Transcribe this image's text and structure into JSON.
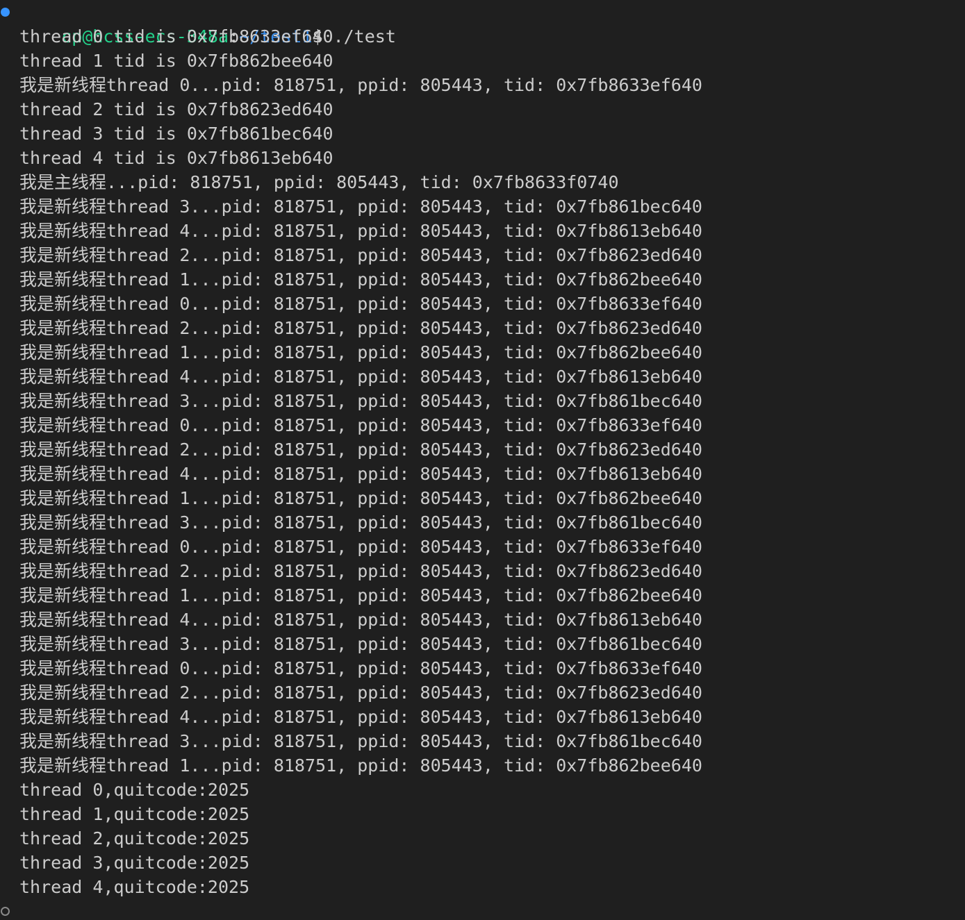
{
  "prompt": {
    "user_host": "cp@hcss-ecs-348a",
    "cwd": "~/test1",
    "symbol": "$",
    "command": " ./test"
  },
  "output_lines": [
    "thread 0 tid is 0x7fb8633ef640",
    "thread 1 tid is 0x7fb862bee640",
    "我是新线程thread 0...pid: 818751, ppid: 805443, tid: 0x7fb8633ef640",
    "thread 2 tid is 0x7fb8623ed640",
    "thread 3 tid is 0x7fb861bec640",
    "thread 4 tid is 0x7fb8613eb640",
    "我是主线程...pid: 818751, ppid: 805443, tid: 0x7fb8633f0740",
    "我是新线程thread 3...pid: 818751, ppid: 805443, tid: 0x7fb861bec640",
    "我是新线程thread 4...pid: 818751, ppid: 805443, tid: 0x7fb8613eb640",
    "我是新线程thread 2...pid: 818751, ppid: 805443, tid: 0x7fb8623ed640",
    "我是新线程thread 1...pid: 818751, ppid: 805443, tid: 0x7fb862bee640",
    "我是新线程thread 0...pid: 818751, ppid: 805443, tid: 0x7fb8633ef640",
    "我是新线程thread 2...pid: 818751, ppid: 805443, tid: 0x7fb8623ed640",
    "我是新线程thread 1...pid: 818751, ppid: 805443, tid: 0x7fb862bee640",
    "我是新线程thread 4...pid: 818751, ppid: 805443, tid: 0x7fb8613eb640",
    "我是新线程thread 3...pid: 818751, ppid: 805443, tid: 0x7fb861bec640",
    "我是新线程thread 0...pid: 818751, ppid: 805443, tid: 0x7fb8633ef640",
    "我是新线程thread 2...pid: 818751, ppid: 805443, tid: 0x7fb8623ed640",
    "我是新线程thread 4...pid: 818751, ppid: 805443, tid: 0x7fb8613eb640",
    "我是新线程thread 1...pid: 818751, ppid: 805443, tid: 0x7fb862bee640",
    "我是新线程thread 3...pid: 818751, ppid: 805443, tid: 0x7fb861bec640",
    "我是新线程thread 0...pid: 818751, ppid: 805443, tid: 0x7fb8633ef640",
    "我是新线程thread 2...pid: 818751, ppid: 805443, tid: 0x7fb8623ed640",
    "我是新线程thread 1...pid: 818751, ppid: 805443, tid: 0x7fb862bee640",
    "我是新线程thread 4...pid: 818751, ppid: 805443, tid: 0x7fb8613eb640",
    "我是新线程thread 3...pid: 818751, ppid: 805443, tid: 0x7fb861bec640",
    "我是新线程thread 0...pid: 818751, ppid: 805443, tid: 0x7fb8633ef640",
    "我是新线程thread 2...pid: 818751, ppid: 805443, tid: 0x7fb8623ed640",
    "我是新线程thread 4...pid: 818751, ppid: 805443, tid: 0x7fb8613eb640",
    "我是新线程thread 3...pid: 818751, ppid: 805443, tid: 0x7fb861bec640",
    "我是新线程thread 1...pid: 818751, ppid: 805443, tid: 0x7fb862bee640",
    "thread 0,quitcode:2025",
    "thread 1,quitcode:2025",
    "thread 2,quitcode:2025",
    "thread 3,quitcode:2025",
    "thread 4,quitcode:2025"
  ],
  "colors": {
    "background": "#1f1f1f",
    "foreground": "#cccccc",
    "prompt_user": "#23d18b",
    "prompt_path": "#3b8eea",
    "decoration_success": "#3794ff",
    "decoration_pending": "#8a8a8a"
  },
  "icons": {
    "first_prompt_decoration": "command-success-dot-icon",
    "last_prompt_decoration": "command-pending-circle-icon"
  }
}
